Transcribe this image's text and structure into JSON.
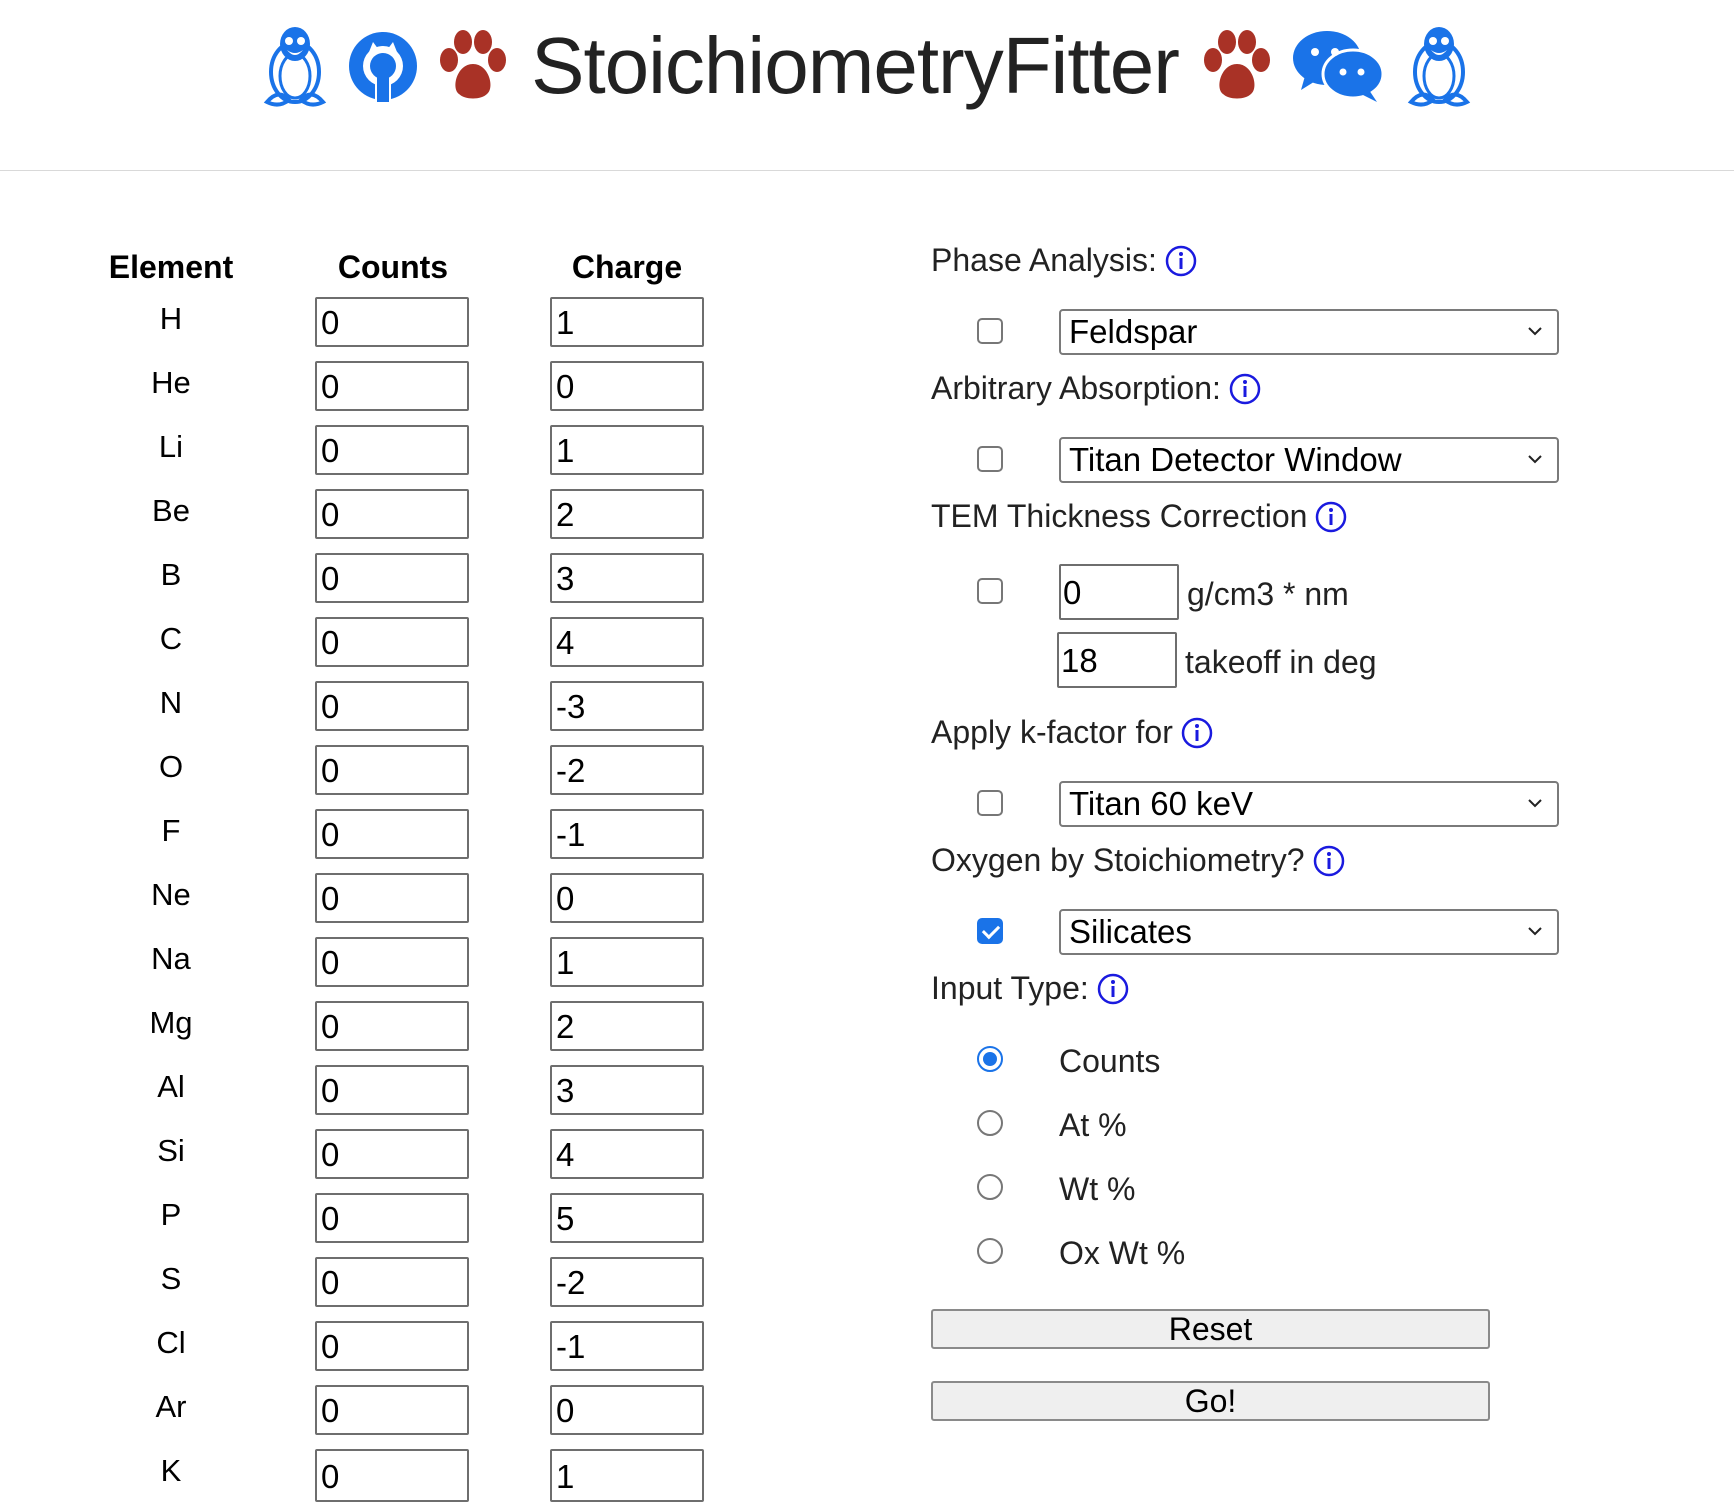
{
  "header": {
    "title": "StoichiometryFitter",
    "icons": [
      "linux-penguin-icon",
      "github-icon",
      "paw-icon",
      "paw-icon",
      "wechat-icon",
      "linux-penguin-icon"
    ],
    "colors": {
      "blue": "#1a73e8",
      "paw": "#a93226"
    }
  },
  "table": {
    "headers": {
      "element": "Element",
      "counts": "Counts",
      "charge": "Charge"
    },
    "rows": [
      {
        "element": "H",
        "counts": "0",
        "charge": "1"
      },
      {
        "element": "He",
        "counts": "0",
        "charge": "0"
      },
      {
        "element": "Li",
        "counts": "0",
        "charge": "1"
      },
      {
        "element": "Be",
        "counts": "0",
        "charge": "2"
      },
      {
        "element": "B",
        "counts": "0",
        "charge": "3"
      },
      {
        "element": "C",
        "counts": "0",
        "charge": "4"
      },
      {
        "element": "N",
        "counts": "0",
        "charge": "-3"
      },
      {
        "element": "O",
        "counts": "0",
        "charge": "-2"
      },
      {
        "element": "F",
        "counts": "0",
        "charge": "-1"
      },
      {
        "element": "Ne",
        "counts": "0",
        "charge": "0"
      },
      {
        "element": "Na",
        "counts": "0",
        "charge": "1"
      },
      {
        "element": "Mg",
        "counts": "0",
        "charge": "2"
      },
      {
        "element": "Al",
        "counts": "0",
        "charge": "3"
      },
      {
        "element": "Si",
        "counts": "0",
        "charge": "4"
      },
      {
        "element": "P",
        "counts": "0",
        "charge": "5"
      },
      {
        "element": "S",
        "counts": "0",
        "charge": "-2"
      },
      {
        "element": "Cl",
        "counts": "0",
        "charge": "-1"
      },
      {
        "element": "Ar",
        "counts": "0",
        "charge": "0"
      },
      {
        "element": "K",
        "counts": "0",
        "charge": "1"
      }
    ]
  },
  "panel": {
    "phase_analysis": {
      "label": "Phase Analysis:",
      "checked": false,
      "selected": "Feldspar"
    },
    "arbitrary_absorption": {
      "label": "Arbitrary Absorption:",
      "checked": false,
      "selected": "Titan Detector Window"
    },
    "tem_thickness": {
      "label": "TEM Thickness Correction",
      "checked": false,
      "thickness_value": "0",
      "thickness_unit": "g/cm3 * nm",
      "takeoff_value": "18",
      "takeoff_unit": "takeoff in deg"
    },
    "kfactor": {
      "label": "Apply k-factor for",
      "checked": false,
      "selected": "Titan 60 keV"
    },
    "oxygen": {
      "label": "Oxygen by Stoichiometry?",
      "checked": true,
      "selected": "Silicates"
    },
    "input_type": {
      "label": "Input Type:",
      "options": [
        "Counts",
        "At %",
        "Wt %",
        "Ox Wt %"
      ],
      "selected": "Counts"
    },
    "reset_label": "Reset",
    "go_label": "Go!"
  }
}
